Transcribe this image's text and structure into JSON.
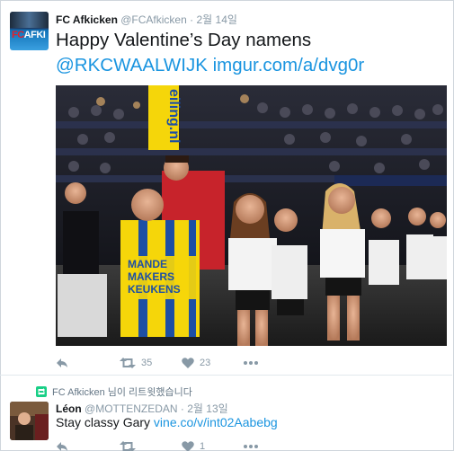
{
  "tweet1": {
    "name": "FC Afkicken",
    "handle": "@FCAfkicken",
    "separator": "·",
    "time": "2월 14일",
    "text_line1": "Happy Valentine’s Day namens",
    "mention": "@RKCWAALWIJK",
    "link": "imgur.com/a/dvg0r",
    "avatar_logo_fc": "FC",
    "avatar_logo_afk": "AFKI",
    "media_banner_text": "eiling.nl",
    "media_shirt_text": [
      "MANDE",
      "MAKERS",
      "KEUKENS"
    ],
    "retweets": "35",
    "likes": "23"
  },
  "retweet_notice": "FC Afkicken 님이 리트윗했습니다",
  "tweet2": {
    "name": "Léon",
    "handle": "@MOTTENZEDAN",
    "separator": "·",
    "time": "2월 13일",
    "text": "Stay classy Gary ",
    "link": "vine.co/v/int02Aabebg",
    "likes": "1"
  },
  "colors": {
    "link": "#1b95e0",
    "meta": "#8899a6",
    "retweet_green": "#19cf86",
    "shirt_yellow": "#f5d60a",
    "shirt_blue": "#1d4fa5"
  }
}
